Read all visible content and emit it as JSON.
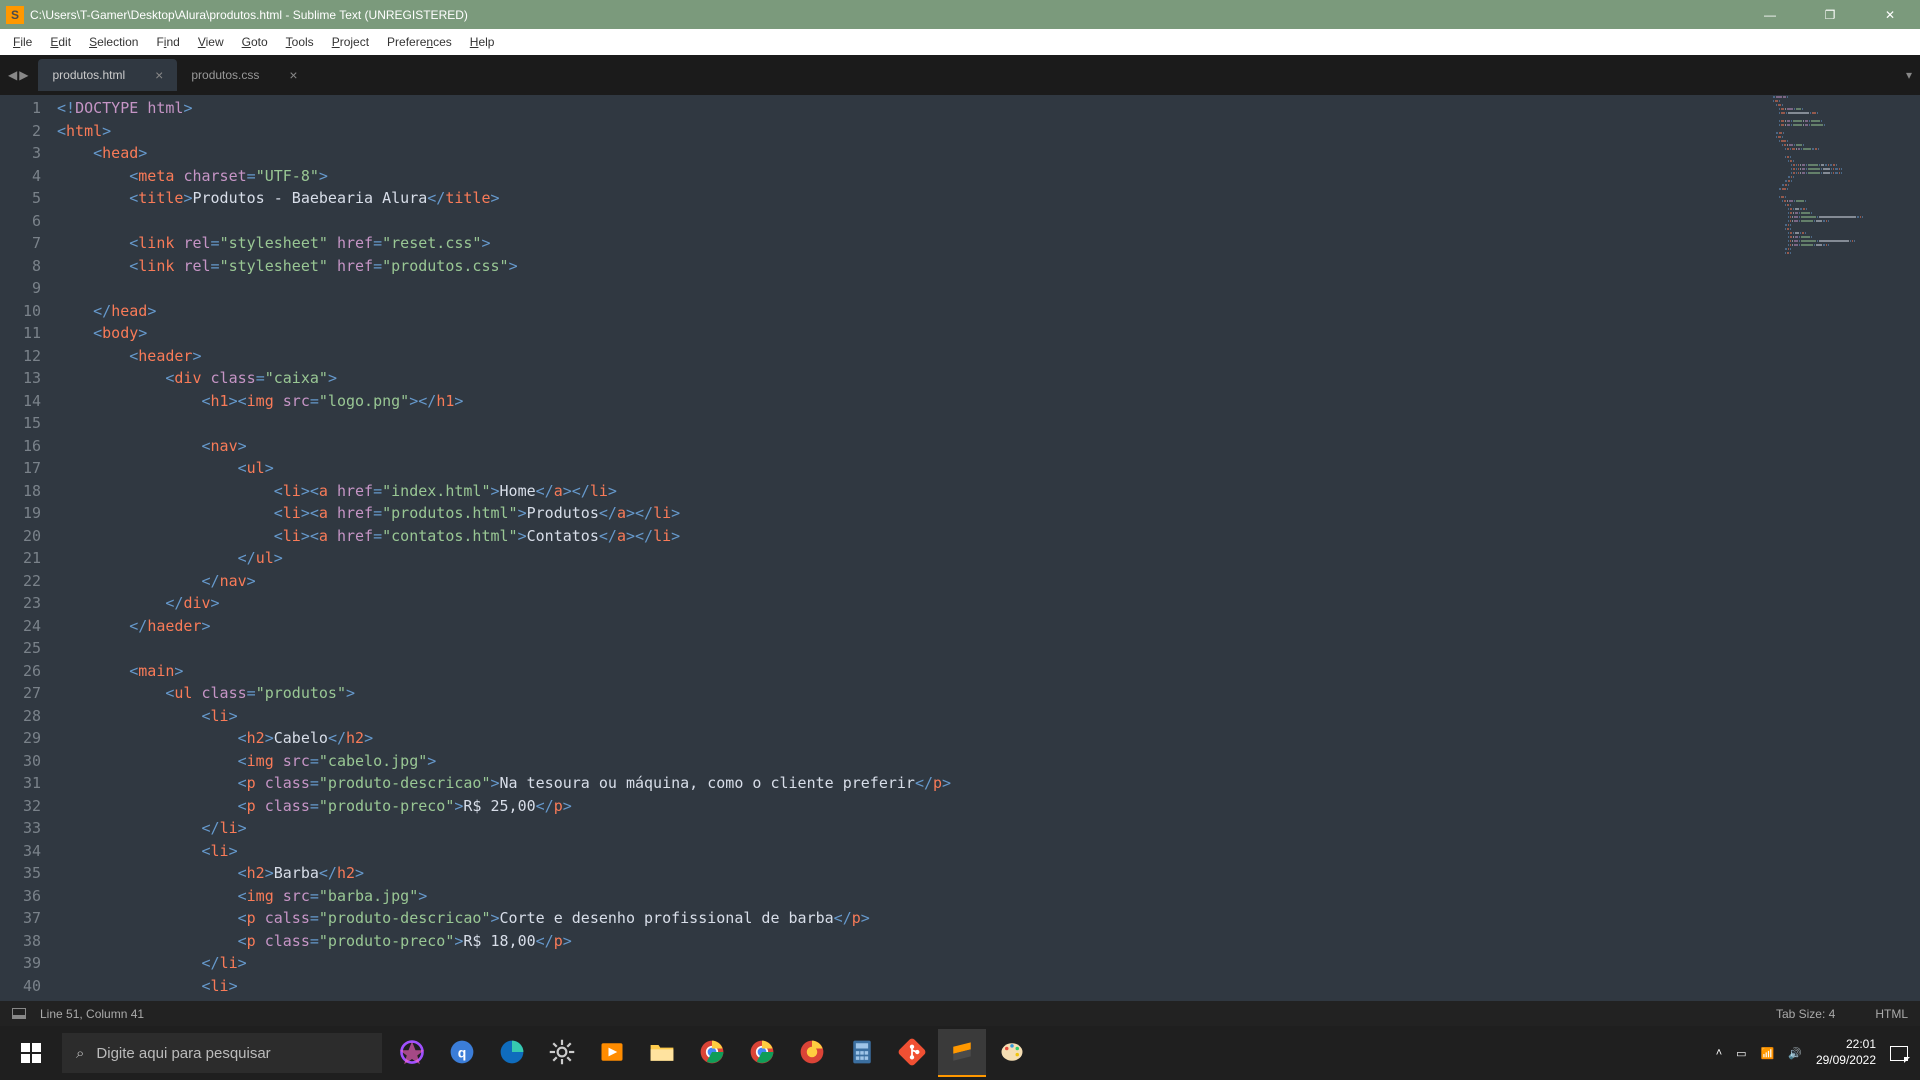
{
  "titlebar": {
    "title": "C:\\Users\\T-Gamer\\Desktop\\Alura\\produtos.html - Sublime Text (UNREGISTERED)"
  },
  "menu": {
    "file": "File",
    "edit": "Edit",
    "selection": "Selection",
    "find": "Find",
    "view": "View",
    "goto": "Goto",
    "tools": "Tools",
    "project": "Project",
    "preferences": "Preferences",
    "help": "Help"
  },
  "tabs": [
    {
      "label": "produtos.html",
      "active": true
    },
    {
      "label": "produtos.css",
      "active": false
    }
  ],
  "gutter": {
    "start": 1,
    "end": 40
  },
  "code_lines": [
    {
      "n": 1,
      "indent": 0,
      "tokens": [
        [
          "punct",
          "<!"
        ],
        [
          "doctype-kw",
          "DOCTYPE "
        ],
        [
          "attr",
          "html"
        ],
        [
          "punct",
          ">"
        ]
      ]
    },
    {
      "n": 2,
      "indent": 0,
      "tokens": [
        [
          "punct",
          "<"
        ],
        [
          "tag",
          "html"
        ],
        [
          "punct",
          ">"
        ]
      ]
    },
    {
      "n": 3,
      "indent": 1,
      "tokens": [
        [
          "punct",
          "<"
        ],
        [
          "tag",
          "head"
        ],
        [
          "punct",
          ">"
        ]
      ]
    },
    {
      "n": 4,
      "indent": 2,
      "tokens": [
        [
          "punct",
          "<"
        ],
        [
          "tag",
          "meta"
        ],
        [
          "txt",
          " "
        ],
        [
          "attr",
          "charset"
        ],
        [
          "punct",
          "="
        ],
        [
          "str",
          "\"UTF-8\""
        ],
        [
          "punct",
          ">"
        ]
      ]
    },
    {
      "n": 5,
      "indent": 2,
      "tokens": [
        [
          "punct",
          "<"
        ],
        [
          "tag",
          "title"
        ],
        [
          "punct",
          ">"
        ],
        [
          "txt",
          "Produtos - Baebearia Alura"
        ],
        [
          "punct",
          "</"
        ],
        [
          "tag",
          "title"
        ],
        [
          "punct",
          ">"
        ]
      ]
    },
    {
      "n": 6,
      "indent": 0,
      "tokens": []
    },
    {
      "n": 7,
      "indent": 2,
      "tokens": [
        [
          "punct",
          "<"
        ],
        [
          "tag",
          "link"
        ],
        [
          "txt",
          " "
        ],
        [
          "attr",
          "rel"
        ],
        [
          "punct",
          "="
        ],
        [
          "str",
          "\"stylesheet\""
        ],
        [
          "txt",
          " "
        ],
        [
          "attr",
          "href"
        ],
        [
          "punct",
          "="
        ],
        [
          "str",
          "\"reset.css\""
        ],
        [
          "punct",
          ">"
        ]
      ]
    },
    {
      "n": 8,
      "indent": 2,
      "tokens": [
        [
          "punct",
          "<"
        ],
        [
          "tag",
          "link"
        ],
        [
          "txt",
          " "
        ],
        [
          "attr",
          "rel"
        ],
        [
          "punct",
          "="
        ],
        [
          "str",
          "\"stylesheet\""
        ],
        [
          "txt",
          " "
        ],
        [
          "attr",
          "href"
        ],
        [
          "punct",
          "="
        ],
        [
          "str",
          "\"produtos.css\""
        ],
        [
          "punct",
          ">"
        ]
      ]
    },
    {
      "n": 9,
      "indent": 0,
      "tokens": []
    },
    {
      "n": 10,
      "indent": 1,
      "tokens": [
        [
          "punct",
          "</"
        ],
        [
          "tag",
          "head"
        ],
        [
          "punct",
          ">"
        ]
      ]
    },
    {
      "n": 11,
      "indent": 1,
      "tokens": [
        [
          "punct",
          "<"
        ],
        [
          "tag",
          "body"
        ],
        [
          "punct",
          ">"
        ]
      ]
    },
    {
      "n": 12,
      "indent": 2,
      "tokens": [
        [
          "punct",
          "<"
        ],
        [
          "tag",
          "header"
        ],
        [
          "punct",
          ">"
        ]
      ]
    },
    {
      "n": 13,
      "indent": 3,
      "tokens": [
        [
          "punct",
          "<"
        ],
        [
          "tag",
          "div"
        ],
        [
          "txt",
          " "
        ],
        [
          "attr",
          "class"
        ],
        [
          "punct",
          "="
        ],
        [
          "str",
          "\"caixa\""
        ],
        [
          "punct",
          ">"
        ]
      ]
    },
    {
      "n": 14,
      "indent": 4,
      "tokens": [
        [
          "punct",
          "<"
        ],
        [
          "tag",
          "h1"
        ],
        [
          "punct",
          "><"
        ],
        [
          "tag",
          "img"
        ],
        [
          "txt",
          " "
        ],
        [
          "attr",
          "src"
        ],
        [
          "punct",
          "="
        ],
        [
          "str",
          "\"logo.png\""
        ],
        [
          "punct",
          "></"
        ],
        [
          "tag",
          "h1"
        ],
        [
          "punct",
          ">"
        ]
      ]
    },
    {
      "n": 15,
      "indent": 0,
      "tokens": []
    },
    {
      "n": 16,
      "indent": 4,
      "tokens": [
        [
          "punct",
          "<"
        ],
        [
          "tag",
          "nav"
        ],
        [
          "punct",
          ">"
        ]
      ]
    },
    {
      "n": 17,
      "indent": 5,
      "tokens": [
        [
          "punct",
          "<"
        ],
        [
          "tag",
          "ul"
        ],
        [
          "punct",
          ">"
        ]
      ]
    },
    {
      "n": 18,
      "indent": 6,
      "tokens": [
        [
          "punct",
          "<"
        ],
        [
          "tag",
          "li"
        ],
        [
          "punct",
          "><"
        ],
        [
          "tag",
          "a"
        ],
        [
          "txt",
          " "
        ],
        [
          "attr",
          "href"
        ],
        [
          "punct",
          "="
        ],
        [
          "str",
          "\"index.html\""
        ],
        [
          "punct",
          ">"
        ],
        [
          "txt",
          "Home"
        ],
        [
          "punct",
          "</"
        ],
        [
          "tag",
          "a"
        ],
        [
          "punct",
          "></"
        ],
        [
          "tag",
          "li"
        ],
        [
          "punct",
          ">"
        ]
      ]
    },
    {
      "n": 19,
      "indent": 6,
      "tokens": [
        [
          "punct",
          "<"
        ],
        [
          "tag",
          "li"
        ],
        [
          "punct",
          "><"
        ],
        [
          "tag",
          "a"
        ],
        [
          "txt",
          " "
        ],
        [
          "attr",
          "href"
        ],
        [
          "punct",
          "="
        ],
        [
          "str",
          "\"produtos.html\""
        ],
        [
          "punct",
          ">"
        ],
        [
          "txt",
          "Produtos"
        ],
        [
          "punct",
          "</"
        ],
        [
          "tag",
          "a"
        ],
        [
          "punct",
          "></"
        ],
        [
          "tag",
          "li"
        ],
        [
          "punct",
          ">"
        ]
      ]
    },
    {
      "n": 20,
      "indent": 6,
      "tokens": [
        [
          "punct",
          "<"
        ],
        [
          "tag",
          "li"
        ],
        [
          "punct",
          "><"
        ],
        [
          "tag",
          "a"
        ],
        [
          "txt",
          " "
        ],
        [
          "attr",
          "href"
        ],
        [
          "punct",
          "="
        ],
        [
          "str",
          "\"contatos.html\""
        ],
        [
          "punct",
          ">"
        ],
        [
          "txt",
          "Contatos"
        ],
        [
          "punct",
          "</"
        ],
        [
          "tag",
          "a"
        ],
        [
          "punct",
          "></"
        ],
        [
          "tag",
          "li"
        ],
        [
          "punct",
          ">"
        ]
      ]
    },
    {
      "n": 21,
      "indent": 5,
      "tokens": [
        [
          "punct",
          "</"
        ],
        [
          "tag",
          "ul"
        ],
        [
          "punct",
          ">"
        ]
      ]
    },
    {
      "n": 22,
      "indent": 4,
      "tokens": [
        [
          "punct",
          "</"
        ],
        [
          "tag",
          "nav"
        ],
        [
          "punct",
          ">"
        ]
      ]
    },
    {
      "n": 23,
      "indent": 3,
      "tokens": [
        [
          "punct",
          "</"
        ],
        [
          "tag",
          "div"
        ],
        [
          "punct",
          ">"
        ]
      ]
    },
    {
      "n": 24,
      "indent": 2,
      "tokens": [
        [
          "punct",
          "</"
        ],
        [
          "tag",
          "haeder"
        ],
        [
          "punct",
          ">"
        ]
      ]
    },
    {
      "n": 25,
      "indent": 0,
      "tokens": []
    },
    {
      "n": 26,
      "indent": 2,
      "tokens": [
        [
          "punct",
          "<"
        ],
        [
          "tag",
          "main"
        ],
        [
          "punct",
          ">"
        ]
      ]
    },
    {
      "n": 27,
      "indent": 3,
      "tokens": [
        [
          "punct",
          "<"
        ],
        [
          "tag",
          "ul"
        ],
        [
          "txt",
          " "
        ],
        [
          "attr",
          "class"
        ],
        [
          "punct",
          "="
        ],
        [
          "str",
          "\"produtos\""
        ],
        [
          "punct",
          ">"
        ]
      ]
    },
    {
      "n": 28,
      "indent": 4,
      "tokens": [
        [
          "punct",
          "<"
        ],
        [
          "tag",
          "li"
        ],
        [
          "punct",
          ">"
        ]
      ]
    },
    {
      "n": 29,
      "indent": 5,
      "tokens": [
        [
          "punct",
          "<"
        ],
        [
          "tag",
          "h2"
        ],
        [
          "punct",
          ">"
        ],
        [
          "txt",
          "Cabelo"
        ],
        [
          "punct",
          "</"
        ],
        [
          "tag",
          "h2"
        ],
        [
          "punct",
          ">"
        ]
      ]
    },
    {
      "n": 30,
      "indent": 5,
      "tokens": [
        [
          "punct",
          "<"
        ],
        [
          "tag",
          "img"
        ],
        [
          "txt",
          " "
        ],
        [
          "attr",
          "src"
        ],
        [
          "punct",
          "="
        ],
        [
          "str",
          "\"cabelo.jpg\""
        ],
        [
          "punct",
          ">"
        ]
      ]
    },
    {
      "n": 31,
      "indent": 5,
      "tokens": [
        [
          "punct",
          "<"
        ],
        [
          "tag",
          "p"
        ],
        [
          "txt",
          " "
        ],
        [
          "attr",
          "class"
        ],
        [
          "punct",
          "="
        ],
        [
          "str",
          "\"produto-descricao\""
        ],
        [
          "punct",
          ">"
        ],
        [
          "txt",
          "Na tesoura ou máquina, como o cliente preferir"
        ],
        [
          "punct",
          "</"
        ],
        [
          "tag",
          "p"
        ],
        [
          "punct",
          ">"
        ]
      ]
    },
    {
      "n": 32,
      "indent": 5,
      "tokens": [
        [
          "punct",
          "<"
        ],
        [
          "tag",
          "p"
        ],
        [
          "txt",
          " "
        ],
        [
          "attr",
          "class"
        ],
        [
          "punct",
          "="
        ],
        [
          "str",
          "\"produto-preco\""
        ],
        [
          "punct",
          ">"
        ],
        [
          "txt",
          "R$ 25,00"
        ],
        [
          "punct",
          "</"
        ],
        [
          "tag",
          "p"
        ],
        [
          "punct",
          ">"
        ]
      ]
    },
    {
      "n": 33,
      "indent": 4,
      "tokens": [
        [
          "punct",
          "</"
        ],
        [
          "tag",
          "li"
        ],
        [
          "punct",
          ">"
        ]
      ]
    },
    {
      "n": 34,
      "indent": 4,
      "tokens": [
        [
          "punct",
          "<"
        ],
        [
          "tag",
          "li"
        ],
        [
          "punct",
          ">"
        ]
      ]
    },
    {
      "n": 35,
      "indent": 5,
      "tokens": [
        [
          "punct",
          "<"
        ],
        [
          "tag",
          "h2"
        ],
        [
          "punct",
          ">"
        ],
        [
          "txt",
          "Barba"
        ],
        [
          "punct",
          "</"
        ],
        [
          "tag",
          "h2"
        ],
        [
          "punct",
          ">"
        ]
      ]
    },
    {
      "n": 36,
      "indent": 5,
      "tokens": [
        [
          "punct",
          "<"
        ],
        [
          "tag",
          "img"
        ],
        [
          "txt",
          " "
        ],
        [
          "attr",
          "src"
        ],
        [
          "punct",
          "="
        ],
        [
          "str",
          "\"barba.jpg\""
        ],
        [
          "punct",
          ">"
        ]
      ]
    },
    {
      "n": 37,
      "indent": 5,
      "tokens": [
        [
          "punct",
          "<"
        ],
        [
          "tag",
          "p"
        ],
        [
          "txt",
          " "
        ],
        [
          "attr",
          "calss"
        ],
        [
          "punct",
          "="
        ],
        [
          "str",
          "\"produto-descricao\""
        ],
        [
          "punct",
          ">"
        ],
        [
          "txt",
          "Corte e desenho profissional de barba"
        ],
        [
          "punct",
          "</"
        ],
        [
          "tag",
          "p"
        ],
        [
          "punct",
          ">"
        ]
      ]
    },
    {
      "n": 38,
      "indent": 5,
      "tokens": [
        [
          "punct",
          "<"
        ],
        [
          "tag",
          "p"
        ],
        [
          "txt",
          " "
        ],
        [
          "attr",
          "class"
        ],
        [
          "punct",
          "="
        ],
        [
          "str",
          "\"produto-preco\""
        ],
        [
          "punct",
          ">"
        ],
        [
          "txt",
          "R$ 18,00"
        ],
        [
          "punct",
          "</"
        ],
        [
          "tag",
          "p"
        ],
        [
          "punct",
          ">"
        ]
      ]
    },
    {
      "n": 39,
      "indent": 4,
      "tokens": [
        [
          "punct",
          "</"
        ],
        [
          "tag",
          "li"
        ],
        [
          "punct",
          ">"
        ]
      ]
    },
    {
      "n": 40,
      "indent": 4,
      "tokens": [
        [
          "punct",
          "<"
        ],
        [
          "tag",
          "li"
        ],
        [
          "punct",
          ">"
        ]
      ]
    }
  ],
  "statusbar": {
    "cursor": "Line 51, Column 41",
    "tab_size": "Tab Size: 4",
    "syntax": "HTML"
  },
  "taskbar": {
    "search_placeholder": "Digite aqui para pesquisar",
    "time": "22:01",
    "date": "29/09/2022"
  }
}
